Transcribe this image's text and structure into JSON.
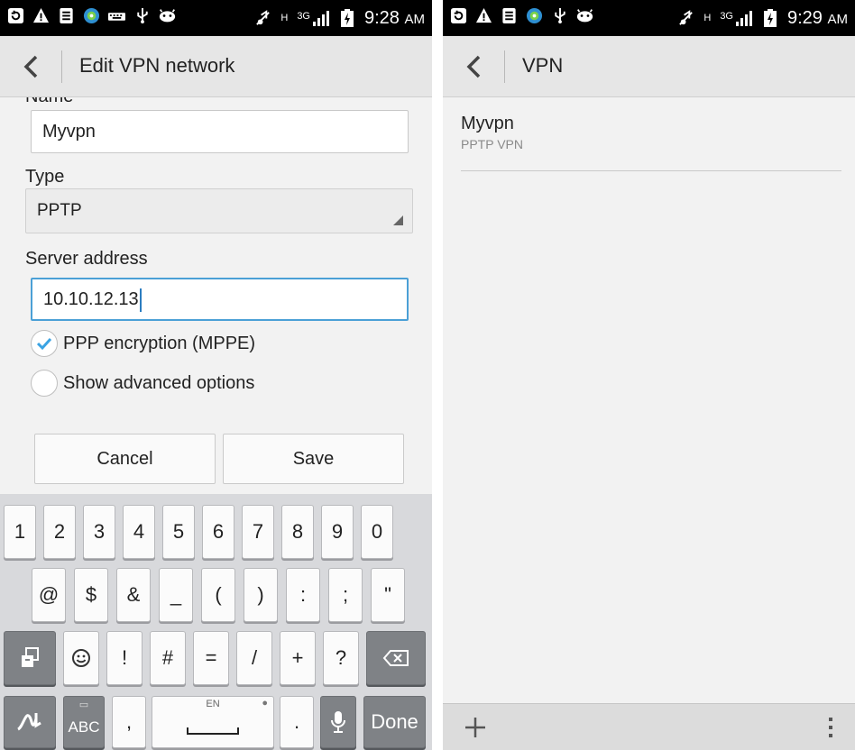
{
  "left_screen": {
    "status_bar": {
      "time": "9:28",
      "ampm": "AM",
      "network": "3G",
      "signal_h": "H",
      "icons": [
        "sync-icon",
        "warning-icon",
        "sim-icon",
        "notification-app-icon",
        "keyboard-icon",
        "usb-icon",
        "game-icon",
        "mute-icon",
        "signal-icon",
        "battery-charging-icon"
      ]
    },
    "action_bar": {
      "title": "Edit VPN network"
    },
    "form": {
      "name_label": "Name",
      "name_value": "Myvpn",
      "type_label": "Type",
      "type_value": "PPTP",
      "server_label": "Server address",
      "server_value": "10.10.12.13",
      "ppp_encryption_label": "PPP encryption (MPPE)",
      "ppp_encryption_checked": true,
      "advanced_label": "Show advanced options",
      "advanced_checked": false,
      "cancel_label": "Cancel",
      "save_label": "Save"
    },
    "keyboard": {
      "row1": [
        "1",
        "2",
        "3",
        "4",
        "5",
        "6",
        "7",
        "8",
        "9",
        "0"
      ],
      "row2": [
        "@",
        "$",
        "&",
        "_",
        "(",
        ")",
        ":",
        ";",
        "\""
      ],
      "row3": [
        "!",
        "#",
        "=",
        "/",
        "+",
        "?"
      ],
      "row4": {
        "abc": "ABC",
        "comma": ",",
        "space_lang": "EN",
        "period": ".",
        "done": "Done"
      }
    }
  },
  "right_screen": {
    "status_bar": {
      "time": "9:29",
      "ampm": "AM",
      "network": "3G",
      "signal_h": "H"
    },
    "action_bar": {
      "title": "VPN"
    },
    "vpn_list": [
      {
        "name": "Myvpn",
        "type": "PPTP VPN"
      }
    ]
  },
  "colors": {
    "accent_blue": "#33b5e5",
    "focus_border": "#4ba0d6",
    "status_bar": "#000000",
    "action_bar": "#e6e6e6"
  }
}
